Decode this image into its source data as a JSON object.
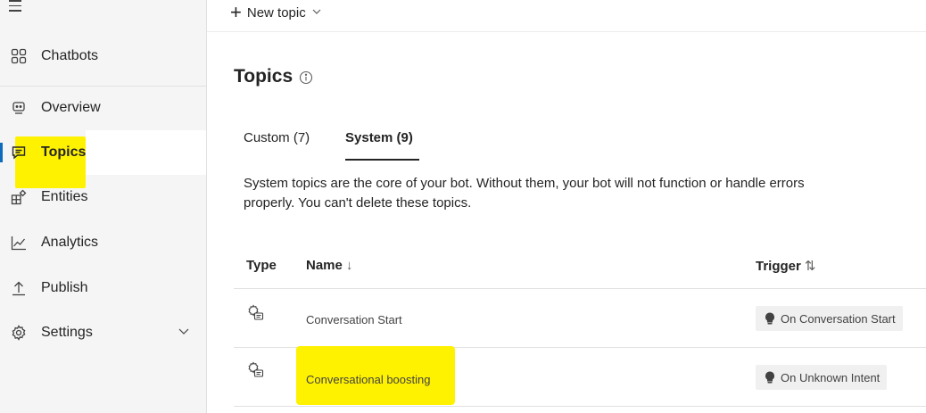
{
  "sidebar": {
    "items": [
      {
        "label": "Chatbots",
        "icon": "grid-icon"
      },
      {
        "label": "Overview",
        "icon": "bot-icon"
      },
      {
        "label": "Topics",
        "icon": "chat-icon"
      },
      {
        "label": "Entities",
        "icon": "entities-icon"
      },
      {
        "label": "Analytics",
        "icon": "chart-icon"
      },
      {
        "label": "Publish",
        "icon": "upload-icon"
      },
      {
        "label": "Settings",
        "icon": "gear-icon"
      }
    ],
    "active": "Topics"
  },
  "toolbar": {
    "new_topic_label": "New topic"
  },
  "page": {
    "title": "Topics",
    "tabs": [
      {
        "label": "Custom (7)",
        "selected": false
      },
      {
        "label": "System (9)",
        "selected": true
      }
    ],
    "description": "System topics are the core of your bot. Without them, your bot will not function or handle errors properly. You can't delete these topics."
  },
  "table": {
    "columns": {
      "type": "Type",
      "name": "Name",
      "trigger": "Trigger"
    },
    "rows": [
      {
        "name": "Conversation Start",
        "trigger": "On Conversation Start"
      },
      {
        "name": "Conversational boosting",
        "trigger": "On Unknown Intent"
      }
    ]
  },
  "colors": {
    "highlight": "#fff200",
    "accent": "#0f6cbd"
  }
}
